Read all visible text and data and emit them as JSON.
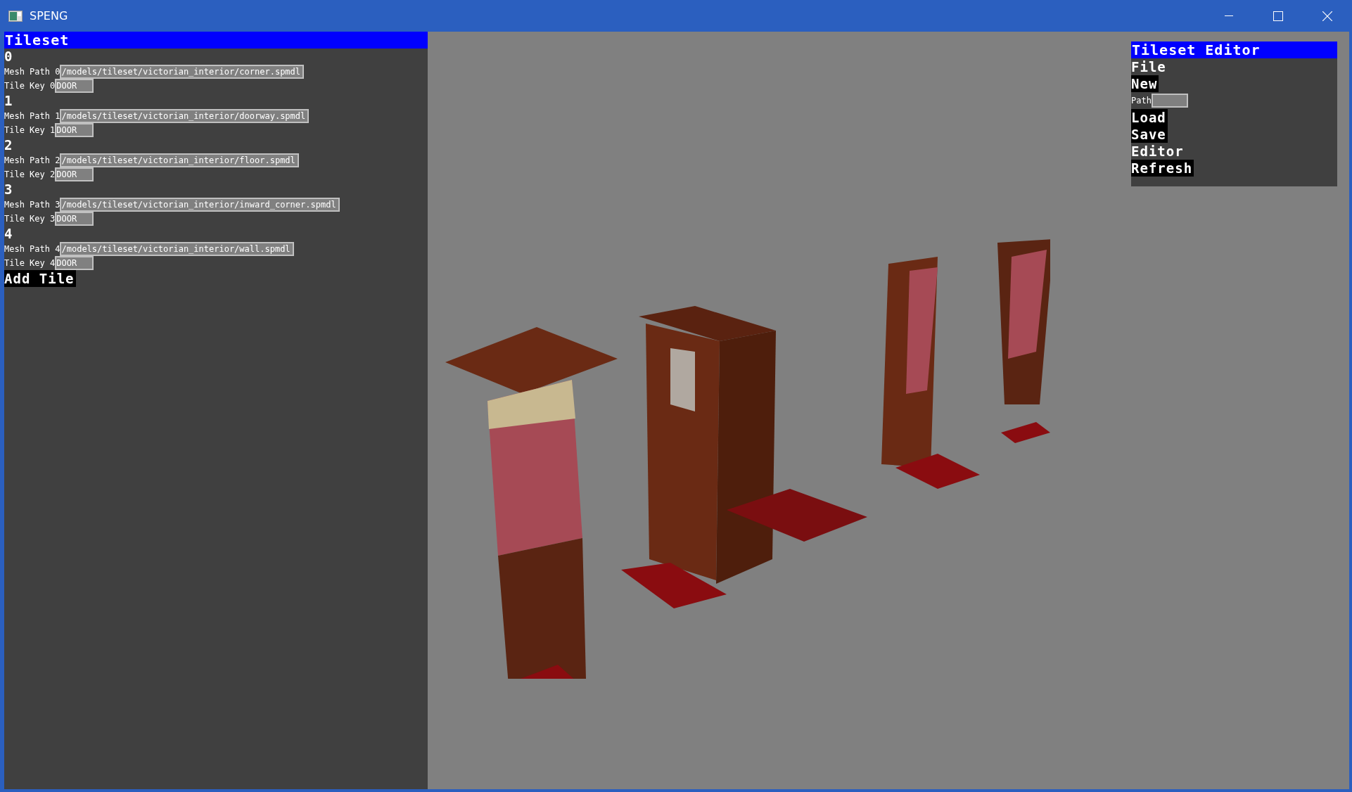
{
  "window": {
    "title": "SPENG"
  },
  "tileset_panel": {
    "title": "Tileset",
    "tiles": [
      {
        "index": "0",
        "mesh_label": "Mesh Path 0",
        "mesh_path": "/models/tileset/victorian_interior/corner.spmdl",
        "key_label": "Tile Key 0",
        "tile_key": "DOOR"
      },
      {
        "index": "1",
        "mesh_label": "Mesh Path 1",
        "mesh_path": "/models/tileset/victorian_interior/doorway.spmdl",
        "key_label": "Tile Key 1",
        "tile_key": "DOOR"
      },
      {
        "index": "2",
        "mesh_label": "Mesh Path 2",
        "mesh_path": "/models/tileset/victorian_interior/floor.spmdl",
        "key_label": "Tile Key 2",
        "tile_key": "DOOR"
      },
      {
        "index": "3",
        "mesh_label": "Mesh Path 3",
        "mesh_path": "/models/tileset/victorian_interior/inward_corner.spmdl",
        "key_label": "Tile Key 3",
        "tile_key": "DOOR"
      },
      {
        "index": "4",
        "mesh_label": "Mesh Path 4",
        "mesh_path": "/models/tileset/victorian_interior/wall.spmdl",
        "key_label": "Tile Key 4",
        "tile_key": "DOOR"
      }
    ],
    "add_button": "Add Tile"
  },
  "editor_panel": {
    "title": "Tileset Editor",
    "items": [
      {
        "kind": "label",
        "text": "File"
      },
      {
        "kind": "button",
        "text": "New"
      },
      {
        "kind": "field",
        "text": "Path"
      },
      {
        "kind": "button",
        "text": "Load"
      },
      {
        "kind": "button",
        "text": "Save"
      },
      {
        "kind": "label",
        "text": "Editor"
      },
      {
        "kind": "button",
        "text": "Refresh"
      }
    ]
  }
}
